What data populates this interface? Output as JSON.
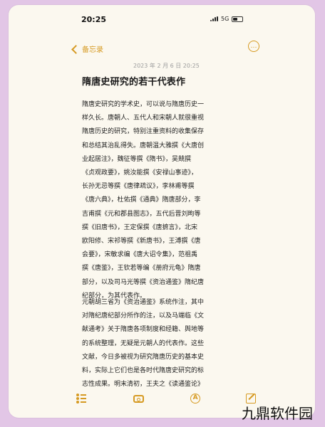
{
  "status_bar": {
    "time": "20:25",
    "location_icon": "arrow-icon",
    "network": "5G"
  },
  "nav": {
    "back_label": "备忘录",
    "more_icon": "ellipsis-circle-icon"
  },
  "note": {
    "date": "2023 年 2 月 6 日 20:25",
    "title": "隋唐史研究的若干代表作",
    "paragraph1": "隋唐史研究的学术史，可以说与隋唐历史一\n样久长。唐朝人、五代人和宋朝人就很重视\n隋唐历史的研究，特别注重资料的收集保存\n和总结其治乱得失。唐朝温大雅撰《大唐创\n业起居注》，魏征等撰《隋书》，吴兢撰\n《贞观政要》，姚汝能撰《安禄山事迹》，\n长孙无忌等撰《唐律疏议》，李林甫等撰\n《唐六典》，杜佑撰《通典》隋唐部分，李\n吉甫撰《元和郡县图志》，五代后晋刘昫等\n撰《旧唐书》，王定保撰《唐摭言》，北宋\n欧阳修、宋祁等撰《新唐书》，王溥撰《唐\n会要》，宋敏求编《唐大诏令集》，范祖禹\n撰《唐鉴》，王钦若等编《册府元龟》隋唐\n部分，以及司马光等撰《资治通鉴》隋纪唐\n纪部分，为其代表作。",
    "paragraph2": "元朝胡三省为《资治通鉴》系统作注，其中\n对隋纪唐纪部分所作的注，以及马端临《文\n献通考》关于隋唐各项制度和经籍、舆地等\n的系统整理，无疑是元朝人的代表作。这些\n文献，今日多被视为研究隋唐历史的基本史\n料，实际上它们也是各时代隋唐史研究的标\n志性成果。明末清初，王夫之《读通鉴论》"
  },
  "toolbar": {
    "icons": [
      "checklist-icon",
      "camera-icon",
      "markup-icon",
      "compose-icon"
    ]
  },
  "watermark": {
    "text": "九鼎软件园"
  },
  "colors": {
    "accent": "#d69a22",
    "background": "#fbf8ef",
    "outer_background": "#e2c6e6"
  }
}
